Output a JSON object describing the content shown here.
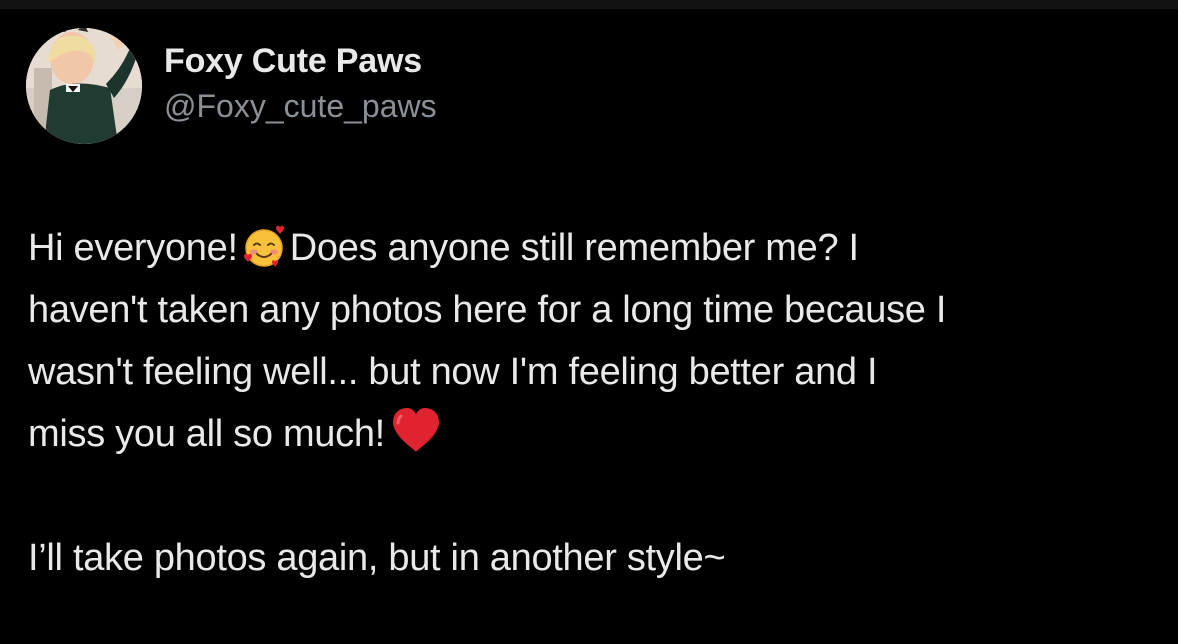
{
  "post": {
    "author": {
      "display_name": "Foxy Cute Paws",
      "handle": "@Foxy_cute_paws",
      "avatar_icon": "avatar-photo"
    },
    "text": {
      "line1_before_emoji": "Hi everyone!",
      "emoji1": "smiling-face-with-hearts-emoji",
      "line1_after_emoji": "Does anyone still remember me? I",
      "line2": "haven't taken any photos here for a long time because I",
      "line3": "wasn't feeling well... but now I'm feeling better and I",
      "line4_before_emoji": "miss you all so much!",
      "emoji2": "red-heart-emoji",
      "line6": "I’ll take photos again, but in another style~"
    }
  },
  "colors": {
    "background": "#000000",
    "text_primary": "#e7e9ea",
    "text_secondary": "#8b9096",
    "heart": "#e0242f"
  }
}
